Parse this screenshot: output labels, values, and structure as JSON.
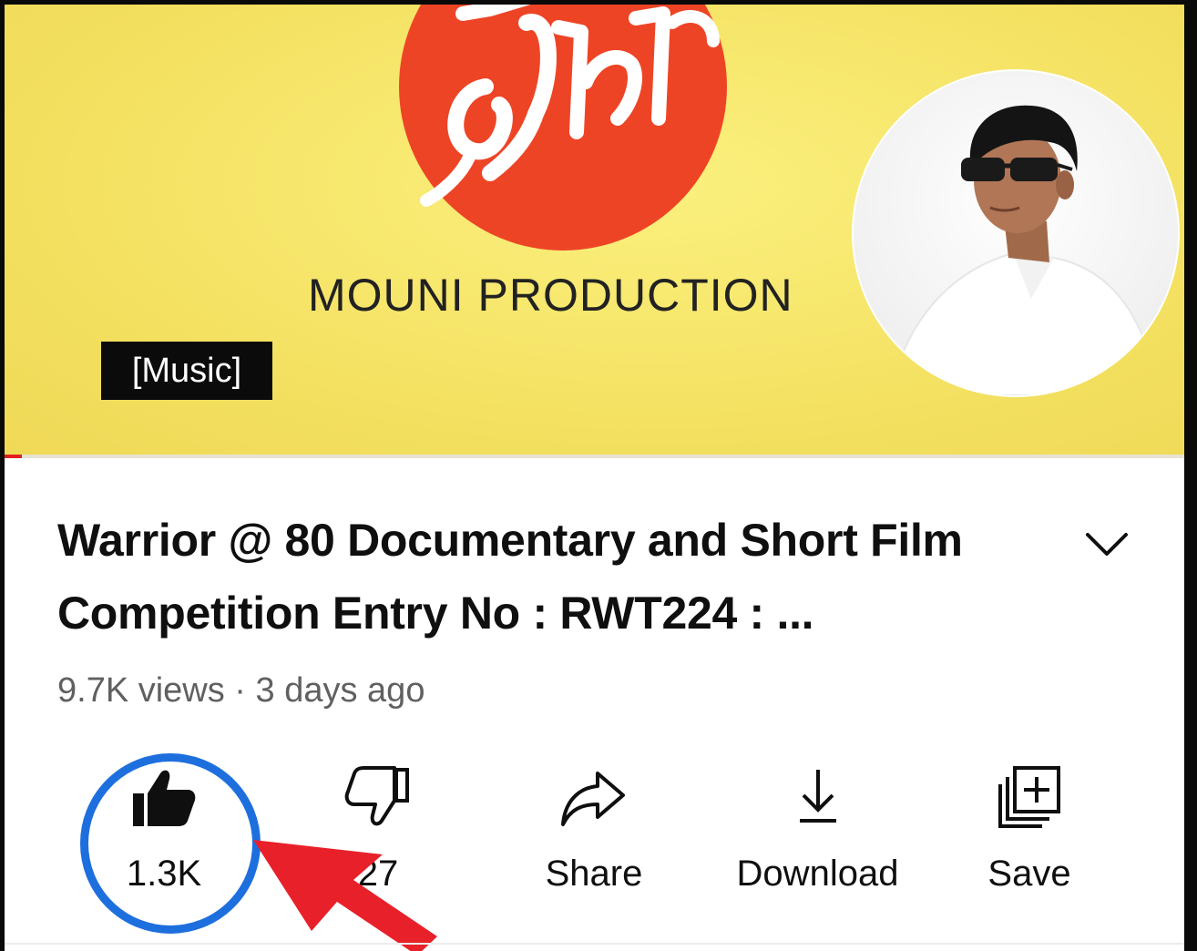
{
  "player": {
    "brand_text": "MOUNI PRODUCTION",
    "caption": "[Music]",
    "progress_fraction": 0.015,
    "colors": {
      "background": "#f6e66b",
      "logo": "#ee4426",
      "progress": "#e02020"
    }
  },
  "video": {
    "title": "Warrior @ 80 Documentary and Short Film Competition Entry No : RWT224 : ...",
    "views": "9.7K views",
    "separator": " · ",
    "age": "3 days ago"
  },
  "actions": {
    "like": {
      "label": "1.3K",
      "icon": "thumb-up-filled-icon"
    },
    "dislike": {
      "label": "27",
      "icon": "thumb-down-icon"
    },
    "share": {
      "label": "Share",
      "icon": "share-arrow-icon"
    },
    "download": {
      "label": "Download",
      "icon": "download-icon"
    },
    "save": {
      "label": "Save",
      "icon": "playlist-add-icon"
    }
  },
  "annotation": {
    "highlight_color": "#1e6fde",
    "arrow_color": "#e8202a"
  }
}
